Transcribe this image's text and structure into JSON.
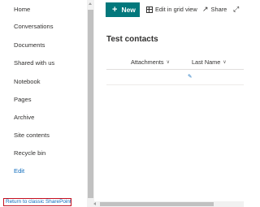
{
  "nav": {
    "items": [
      {
        "label": "Home"
      },
      {
        "label": "Conversations"
      },
      {
        "label": "Documents"
      },
      {
        "label": "Shared with us"
      },
      {
        "label": "Notebook"
      },
      {
        "label": "Pages"
      },
      {
        "label": "Archive"
      },
      {
        "label": "Site contents"
      },
      {
        "label": "Recycle bin"
      },
      {
        "label": "Edit"
      }
    ],
    "return_link": "Return to classic SharePoint"
  },
  "commandbar": {
    "new_label": "New",
    "new_glyph": "+",
    "grid_label": "Edit in grid view",
    "share_label": "Share",
    "share_glyph": "↗",
    "expand_glyph": "⤢"
  },
  "list": {
    "title": "Test contacts",
    "columns": [
      {
        "label": "Attachments",
        "glyph": "∨"
      },
      {
        "label": "Last Name",
        "glyph": "∨"
      }
    ],
    "row_glyph": "✎"
  },
  "colors": {
    "accent": "#03787c",
    "link": "#0f6cbd",
    "highlight_border": "#c50f1f"
  }
}
